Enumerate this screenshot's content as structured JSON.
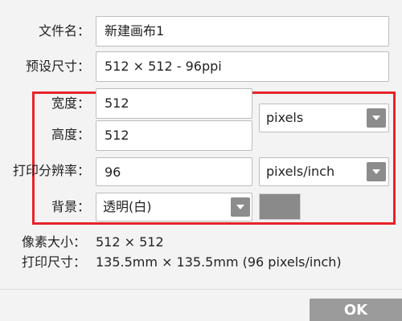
{
  "form": {
    "filename": {
      "label": "文件名：",
      "value": "新建画布1"
    },
    "preset": {
      "label": "预设尺寸：",
      "value": "512 × 512 - 96ppi"
    },
    "width": {
      "label": "宽度：",
      "value": "512"
    },
    "height": {
      "label": "高度：",
      "value": "512"
    },
    "size_unit": {
      "value": "pixels"
    },
    "resolution": {
      "label": "打印分辨率：",
      "value": "96"
    },
    "resolution_unit": {
      "value": "pixels/inch"
    },
    "background": {
      "label": "背景：",
      "value": "透明(白)"
    },
    "background_color": "#8a8a8a"
  },
  "info": {
    "pixel_size_label": "像素大小：",
    "pixel_size_value": "512 × 512",
    "print_size_label": "打印尺寸：",
    "print_size_value": "135.5mm × 135.5mm (96 pixels/inch)"
  },
  "buttons": {
    "ok_label": "OK"
  },
  "colors": {
    "highlight": "#e8232a",
    "button_gray": "#8c8c8c"
  }
}
